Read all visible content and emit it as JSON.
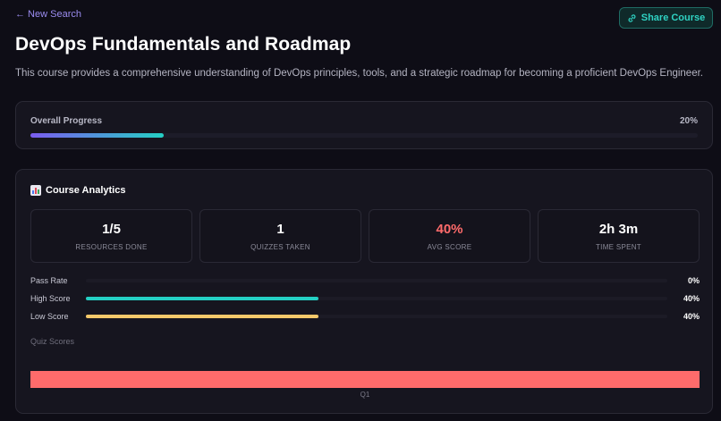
{
  "nav": {
    "back_label": "← New Search"
  },
  "header": {
    "share_label": "Share Course",
    "title": "DevOps Fundamentals and Roadmap",
    "description": "This course provides a comprehensive understanding of DevOps principles, tools, and a strategic roadmap for becoming a proficient DevOps Engineer."
  },
  "progress": {
    "label": "Overall Progress",
    "percent_label": "20%",
    "fraction": 0.2
  },
  "analytics": {
    "title": "Course Analytics",
    "icon": "bar-chart-icon",
    "stats": [
      {
        "value": "1/5",
        "label": "RESOURCES DONE"
      },
      {
        "value": "1",
        "label": "QUIZZES TAKEN"
      },
      {
        "value": "40%",
        "label": "AVG SCORE"
      },
      {
        "value": "2h 3m",
        "label": "TIME SPENT"
      }
    ],
    "metrics": [
      {
        "name": "Pass Rate",
        "value": "0%",
        "fraction": 0.0,
        "color": "#24d0c4"
      },
      {
        "name": "High Score",
        "value": "40%",
        "fraction": 0.4,
        "color": "#24d0c4"
      },
      {
        "name": "Low Score",
        "value": "40%",
        "fraction": 0.4,
        "color": "#f4c86a"
      }
    ],
    "quiz_scores_label": "Quiz Scores"
  },
  "colors": {
    "accent_purple": "#9b8cf0",
    "accent_teal": "#2fd3c3",
    "avg_score": "#ff6b6b",
    "quiz_bar": "#ff6b6b"
  },
  "chart_data": {
    "type": "bar",
    "orientation": "horizontal",
    "categories": [
      "Q1"
    ],
    "values": [
      40
    ],
    "title": "Quiz Scores",
    "xlabel": "",
    "ylabel": "",
    "xlim": [
      0,
      40
    ],
    "grid": false,
    "color": "#ff6b6b"
  }
}
